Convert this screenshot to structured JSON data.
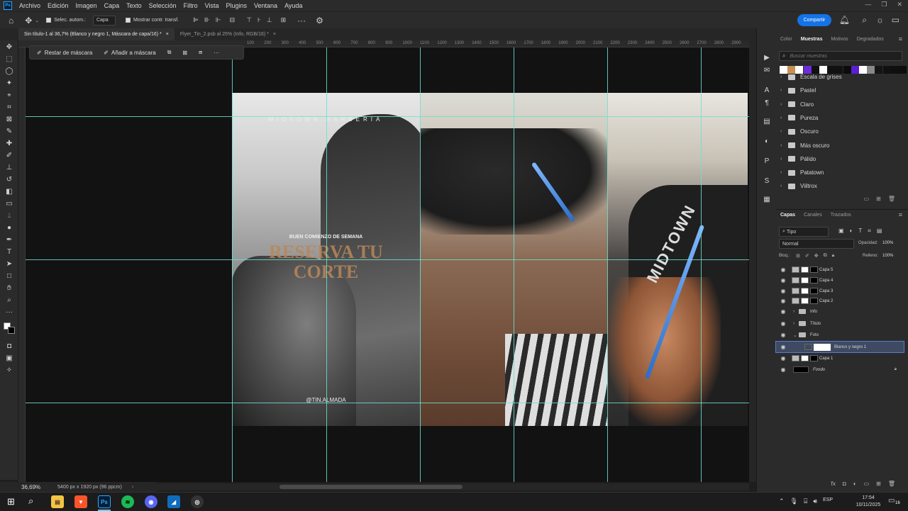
{
  "menu": {
    "app_logo": "Ps",
    "items": [
      "Archivo",
      "Edición",
      "Imagen",
      "Capa",
      "Texto",
      "Selección",
      "Filtro",
      "Vista",
      "Plugins",
      "Ventana",
      "Ayuda"
    ]
  },
  "options": {
    "auto_select_label": "Selec. autom.:",
    "auto_select_value": "Capa",
    "transform_label": "Mostrar contr. transf.",
    "share_label": "Compartir"
  },
  "tabs": [
    {
      "label": "Sin título-1 al 36,7% (Blanco y negro 1, Máscara de capa/16) *",
      "close": "×"
    },
    {
      "label": "Flyer_Tin_2.psb al 25% (Info, RGB/16) *",
      "close": "×"
    }
  ],
  "context_bar": {
    "subtract_label": "Restar de máscara",
    "add_label": "Añadir a máscara",
    "more": "···"
  },
  "ruler_ticks": [
    "100",
    "200",
    "300",
    "400",
    "500",
    "600",
    "700",
    "800",
    "900",
    "1000",
    "1100",
    "1200",
    "1300",
    "1400",
    "1500",
    "1600",
    "1700",
    "1800",
    "1900",
    "2000",
    "2100",
    "2200",
    "2300",
    "2400",
    "2500",
    "2600",
    "2700",
    "2800",
    "2900"
  ],
  "artwork": {
    "brand": "MIDTOWN BARBERIA",
    "tagline": "BUEN COMIENZO DE SEMANA",
    "headline_1": "RESERVA TU",
    "headline_2": "CORTE",
    "handle": "@TIN.ALMADA",
    "shirt_text": "MIDTOWN"
  },
  "status": {
    "zoom": "36,69%",
    "doc_info": "5400 px x 1920 px (96 ppcm)"
  },
  "right_panel": {
    "top_tabs": [
      "Color",
      "Muestras",
      "Motivos",
      "Degradados"
    ],
    "search_placeholder": "Buscar muestras",
    "swatch_colors": [
      "#ffffff",
      "#c69154",
      "#ffffff",
      "#6e2bd9",
      "#111111",
      "#ffffff",
      "#111111",
      "#111111",
      "#0c0c0c",
      "#5a1fd1",
      "#ffffff",
      "#888888",
      "#141414",
      "#111111",
      "#0f0f0f",
      "#0e0e0e"
    ],
    "swatch_groups": [
      "Escala de grises",
      "Pastel",
      "Claro",
      "Pureza",
      "Oscuro",
      "Más oscuro",
      "Pálido",
      "Patatown",
      "Viiltrox"
    ],
    "layer_tabs": [
      "Capas",
      "Canales",
      "Trazados"
    ],
    "filter_kind": "Tipo",
    "blend_mode": "Normal",
    "opacity_label": "Opacidad:",
    "opacity_value": "100%",
    "lock_label": "Bloq.:",
    "fill_label": "Relleno:",
    "fill_value": "100%",
    "layers": [
      {
        "name": "Capa 5",
        "type": "layer"
      },
      {
        "name": "Capa 4",
        "type": "layer"
      },
      {
        "name": "Capa 3",
        "type": "layer"
      },
      {
        "name": "Capa 2",
        "type": "layer"
      },
      {
        "name": "Info",
        "type": "group"
      },
      {
        "name": "Título",
        "type": "group"
      },
      {
        "name": "Foto",
        "type": "group-open"
      },
      {
        "name": "Blanco y negro 1",
        "type": "adjustment"
      },
      {
        "name": "Capa 1",
        "type": "layer"
      },
      {
        "name": "Fondo",
        "type": "background"
      }
    ]
  },
  "taskbar": {
    "apps": [
      "Explorador",
      "Brave",
      "Ps",
      "Spotify",
      "Discord",
      "Visual",
      "Obs"
    ],
    "lang": "ESP",
    "time": "17:54",
    "date": "10/11/2025",
    "notifications": "16"
  }
}
